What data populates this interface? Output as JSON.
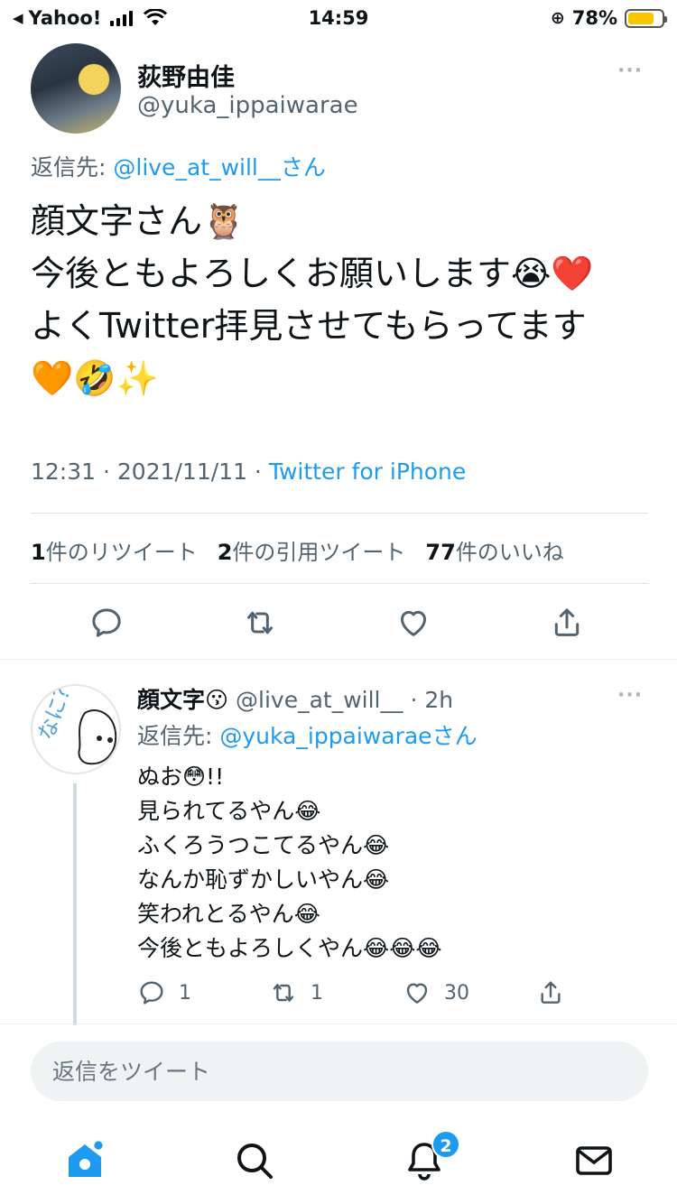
{
  "status_bar": {
    "carrier": "Yahoo!",
    "time": "14:59",
    "battery": "78%",
    "battery_level": 0.78
  },
  "main_tweet": {
    "name": "荻野由佳",
    "handle": "@yuka_ippaiwarae",
    "reply_to_prefix": "返信先: ",
    "reply_to_handle": "@live_at_will__さん",
    "lines": [
      "顔文字さん🦉",
      "今後ともよろしくお願いします😭❤️",
      "よくTwitter拝見させてもらってます",
      "🧡🤣✨"
    ],
    "time": "12:31 · 2021/11/11 · ",
    "source": "Twitter for iPhone",
    "retweets": "1",
    "retweets_label": "件のリツイート",
    "quotes": "2",
    "quotes_label": "件の引用ツイート",
    "likes": "77",
    "likes_label": "件のいいね"
  },
  "reply": {
    "name": "顔文字😗",
    "handle": "@live_at_will__",
    "age": "· 2h",
    "reply_to_prefix": "返信先: ",
    "reply_to_handle": "@yuka_ippaiwaraeさん",
    "lines": [
      "ぬお😳!!",
      "見られてるやん😂",
      "ふくろうつこてるやん😂",
      "なんか恥ずかしいやん😂",
      "笑われとるやん😂",
      "今後ともよろしくやん😂😂😂"
    ],
    "reply_count": "1",
    "retweet_count": "1",
    "like_count": "30",
    "avatar_text": "なに?"
  },
  "compose": {
    "placeholder": "返信をツイート"
  },
  "tabbar": {
    "notifications_badge": "2"
  },
  "colors": {
    "accent": "#1d9bf0",
    "muted": "#536471"
  }
}
